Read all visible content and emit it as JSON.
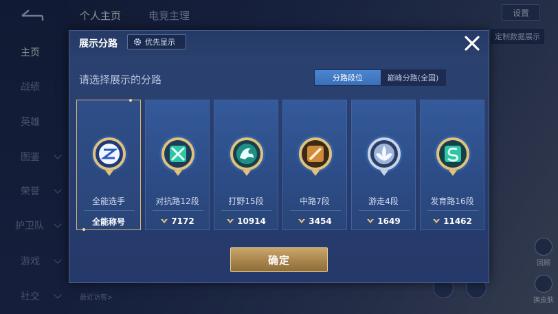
{
  "background": {
    "tabs": [
      "个人主页",
      "电竞主理"
    ],
    "sidebar": [
      "主页",
      "战绩",
      "英雄",
      "图鉴",
      "荣誉",
      "护卫队",
      "游戏",
      "社交"
    ],
    "settings_label": "设置",
    "data_show_label": "定制数据展示",
    "recent_visitors": "最近访客>",
    "right_buttons": [
      "回顾",
      "换皮肤"
    ]
  },
  "dialog": {
    "title": "展示分路",
    "priority_label": "优先显示",
    "prompt": "请选择展示的分路",
    "tabs": [
      {
        "label": "分路段位",
        "active": true
      },
      {
        "label": "巅峰分路(全国)",
        "active": false
      }
    ],
    "cards": [
      {
        "name": "全能选手",
        "score": "全能称号",
        "selected": true,
        "icon": "all-round-emblem-icon"
      },
      {
        "name": "对抗路12段",
        "score": "7172",
        "selected": false,
        "icon": "clash-lane-emblem-icon"
      },
      {
        "name": "打野15段",
        "score": "10914",
        "selected": false,
        "icon": "jungle-emblem-icon"
      },
      {
        "name": "中路7段",
        "score": "3454",
        "selected": false,
        "icon": "mid-lane-emblem-icon"
      },
      {
        "name": "游走4段",
        "score": "1649",
        "selected": false,
        "icon": "roam-emblem-icon"
      },
      {
        "name": "发育路16段",
        "score": "11462",
        "selected": false,
        "icon": "farm-lane-emblem-icon"
      }
    ],
    "confirm_label": "确定"
  },
  "colors": {
    "dialog_bg": "#2c4170",
    "selected_border": "#d9b878",
    "confirm_gold": "#b8955a",
    "active_tab": "#4b86d0"
  }
}
